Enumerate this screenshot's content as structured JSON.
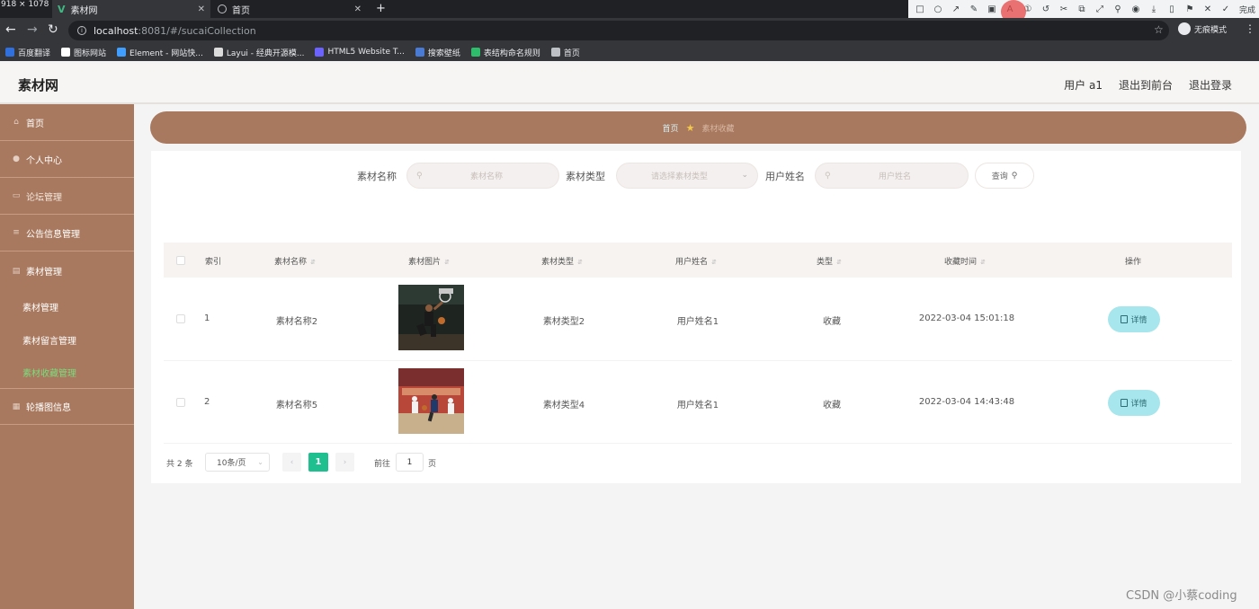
{
  "screen_overlay": {
    "dimensions": "918 × 1078"
  },
  "browser": {
    "tabs": [
      {
        "title": "素材网",
        "close": "✕"
      },
      {
        "title": "首页",
        "close": "✕"
      }
    ],
    "new_tab": "+",
    "url_host": "localhost",
    "url_rest": ":8081/#/sucaiCollection",
    "incognito_label": "无痕模式",
    "extension_done_label": "完成",
    "bookmarks": [
      {
        "label": "百度翻译",
        "color": "#2f6fde"
      },
      {
        "label": "图标网站",
        "color": "#ffffff"
      },
      {
        "label": "Element - 网站快...",
        "color": "#409eff"
      },
      {
        "label": "Layui - 经典开源模...",
        "color": "#dcdcdc"
      },
      {
        "label": "HTML5 Website T...",
        "color": "#6c63ff"
      },
      {
        "label": "搜索壁纸",
        "color": "#4a7bd4"
      },
      {
        "label": "表结构命名规则",
        "color": "#2ebd6b"
      },
      {
        "label": "首页",
        "color": "#bdc1c6"
      }
    ]
  },
  "header": {
    "brand": "素材网",
    "user_label": "用户 a1",
    "back_front_label": "退出到前台",
    "logout_label": "退出登录"
  },
  "sidebar": {
    "items": [
      {
        "label": "首页",
        "icon": "home-icon"
      },
      {
        "label": "个人中心",
        "icon": "user-icon"
      },
      {
        "label": "论坛管理",
        "icon": "forum-icon"
      },
      {
        "label": "公告信息管理",
        "icon": "notice-icon"
      },
      {
        "label": "素材管理",
        "icon": "folder-icon"
      }
    ],
    "sub_items": [
      {
        "label": "素材管理"
      },
      {
        "label": "素材留言管理"
      },
      {
        "label": "素材收藏管理"
      }
    ],
    "last_item": {
      "label": "轮播图信息",
      "icon": "image-icon"
    }
  },
  "breadcrumb": {
    "home": "首页",
    "current": "素材收藏"
  },
  "search": {
    "name_label": "素材名称",
    "name_placeholder": "素材名称",
    "type_label": "素材类型",
    "type_placeholder": "请选择素材类型",
    "user_label": "用户姓名",
    "user_placeholder": "用户姓名",
    "query_label": "查询"
  },
  "table": {
    "headers": [
      "索引",
      "素材名称",
      "素材图片",
      "素材类型",
      "用户姓名",
      "类型",
      "收藏时间",
      "操作"
    ],
    "rows": [
      {
        "index": "1",
        "name": "素材名称2",
        "type": "素材类型2",
        "user": "用户姓名1",
        "kind": "收藏",
        "time": "2022-03-04 15:01:18",
        "action": "详情"
      },
      {
        "index": "2",
        "name": "素材名称5",
        "type": "素材类型4",
        "user": "用户姓名1",
        "kind": "收藏",
        "time": "2022-03-04 14:43:48",
        "action": "详情"
      }
    ]
  },
  "pagination": {
    "total_text": "共 2 条",
    "page_size": "10条/页",
    "prev": "‹",
    "current_page": "1",
    "next": "›",
    "goto_label": "前往",
    "goto_value": "1",
    "page_suffix": "页"
  },
  "watermark": "CSDN @小蔡coding",
  "colors": {
    "sidebar_bg": "#a8795e",
    "active_submenu": "#7ddb7d",
    "pager_active": "#1fbf8f",
    "detail_button": "#a6e6ec"
  }
}
